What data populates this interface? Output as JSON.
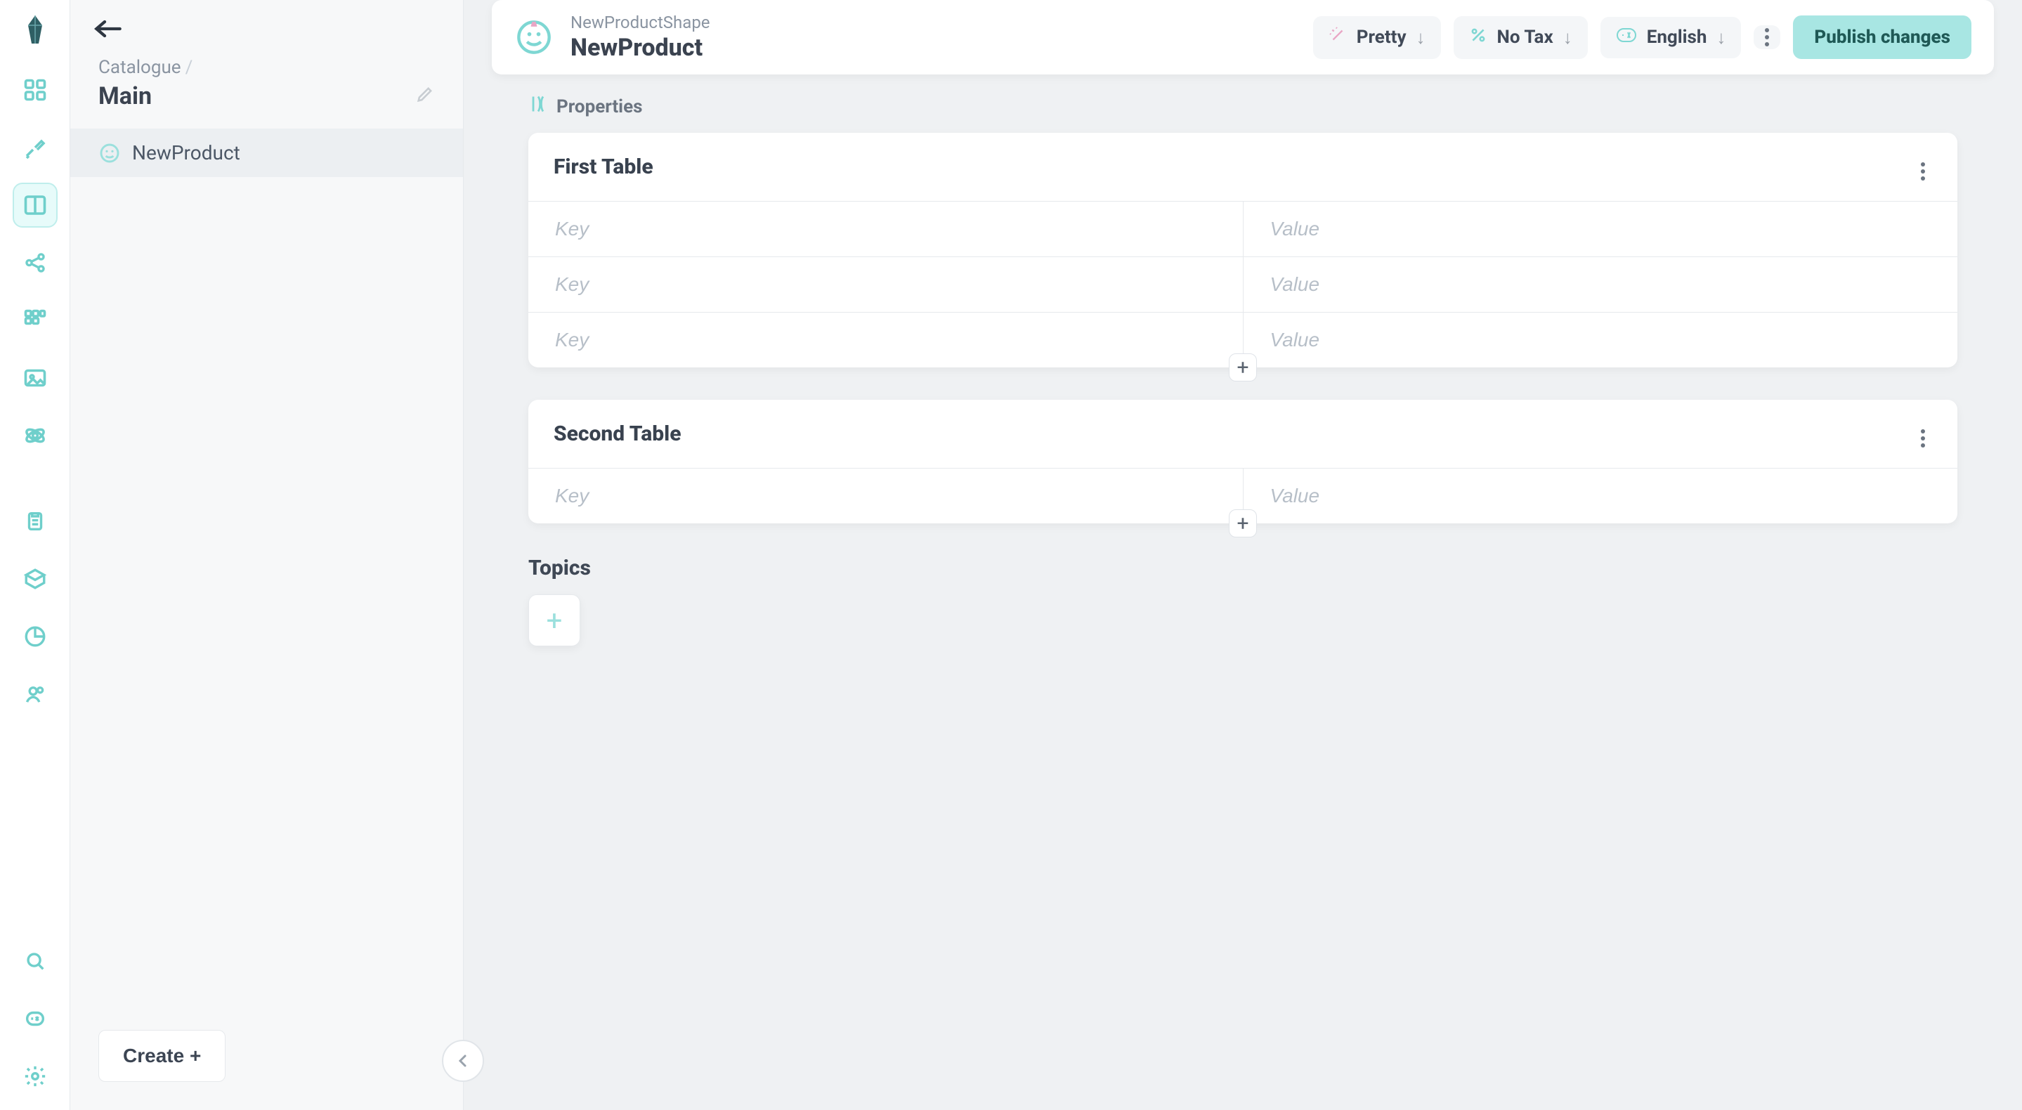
{
  "rail": {
    "icons": [
      {
        "name": "dashboard-icon"
      },
      {
        "name": "pipette-icon"
      },
      {
        "name": "catalogue-icon",
        "active": true
      },
      {
        "name": "share-icon"
      },
      {
        "name": "grid-icon"
      },
      {
        "name": "image-icon"
      },
      {
        "name": "atom-icon"
      }
    ],
    "lower": [
      {
        "name": "clipboard-icon"
      },
      {
        "name": "package-icon"
      },
      {
        "name": "pie-icon"
      },
      {
        "name": "user-icon"
      }
    ],
    "footer": [
      {
        "name": "search-icon"
      },
      {
        "name": "translate-icon"
      },
      {
        "name": "settings-icon"
      }
    ]
  },
  "sidebar": {
    "breadcrumb_root": "Catalogue",
    "title": "Main",
    "items": [
      {
        "label": "NewProduct"
      }
    ],
    "create_label": "Create +"
  },
  "header": {
    "shape": "NewProductShape",
    "name": "NewProduct",
    "pretty": "Pretty",
    "tax": "No Tax",
    "lang": "English",
    "publish": "Publish changes"
  },
  "properties": {
    "section_label": "Properties",
    "tables": [
      {
        "name": "First Table",
        "rows": 3,
        "key_ph": "Key",
        "value_ph": "Value"
      },
      {
        "name": "Second Table",
        "rows": 1,
        "key_ph": "Key",
        "value_ph": "Value"
      }
    ]
  },
  "topics": {
    "title": "Topics"
  }
}
